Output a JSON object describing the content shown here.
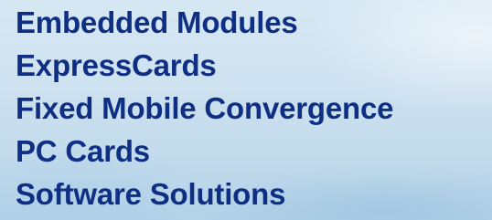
{
  "menu": {
    "items": [
      {
        "label": "Embedded Modules"
      },
      {
        "label": "ExpressCards"
      },
      {
        "label": "Fixed Mobile Convergence"
      },
      {
        "label": "PC Cards"
      },
      {
        "label": "Software Solutions"
      }
    ]
  },
  "colors": {
    "text": "#0f2f84",
    "background_top": "#d7e8f4",
    "background_bottom": "#b4d2e8"
  }
}
